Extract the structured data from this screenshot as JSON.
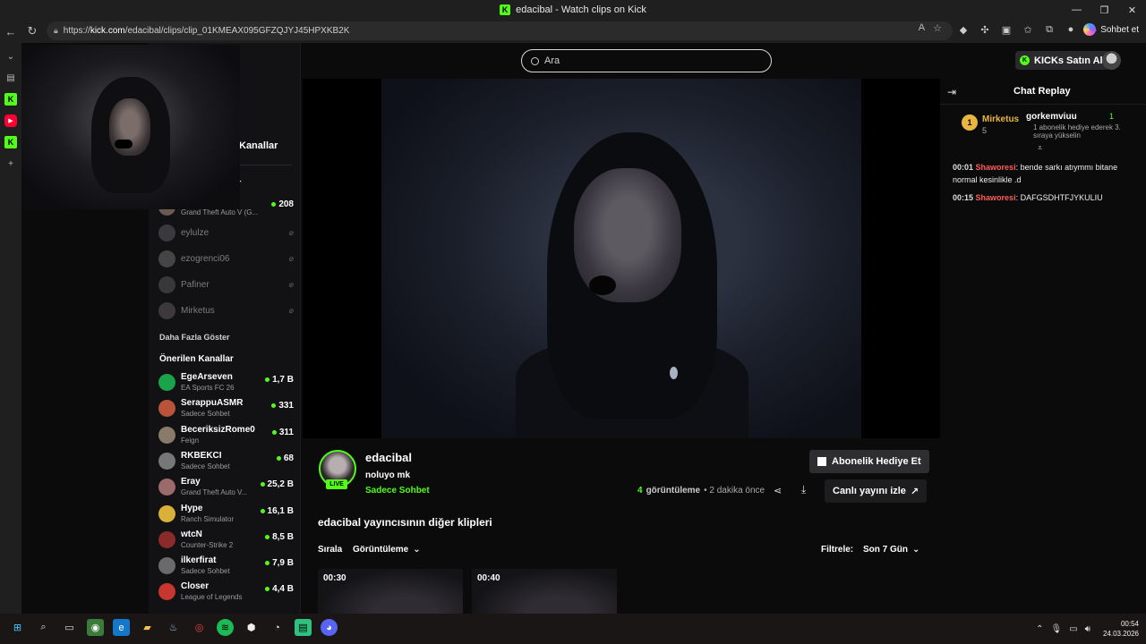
{
  "browser": {
    "window_title": "edacibal - Watch clips on Kick",
    "url_prefix": "https://",
    "url_host": "kick.com",
    "url_path": "/edacibal/clips/clip_01KMEAX095GFZQJYJ45HPXKB2K",
    "copilot_label": "Sohbet et"
  },
  "header": {
    "search_placeholder": "Ara",
    "kicks_button": "KICKs Satın Al"
  },
  "sidebar": {
    "heading": "Kanallar",
    "sub": "r",
    "followed": [
      {
        "name": "",
        "game": "Grand Theft Auto V (G...",
        "viewers": "208",
        "live": true
      },
      {
        "name": "eylulze",
        "live": false
      },
      {
        "name": "ezogrenci06",
        "live": false
      },
      {
        "name": "Pafiner",
        "live": false
      },
      {
        "name": "Mirketus",
        "live": false
      }
    ],
    "show_more": "Daha Fazla Göster",
    "recommended_title": "Önerilen Kanallar",
    "recommended": [
      {
        "name": "EgeArseven",
        "game": "EA Sports FC 26",
        "viewers": "1,7 B"
      },
      {
        "name": "SerappuASMR",
        "game": "Sadece Sohbet",
        "viewers": "331"
      },
      {
        "name": "BeceriksizRome0",
        "game": "Feign",
        "viewers": "311"
      },
      {
        "name": "RKBEKCI",
        "game": "Sadece Sohbet",
        "viewers": "68"
      },
      {
        "name": "Eray",
        "game": "Grand Theft Auto V...",
        "viewers": "25,2 B"
      },
      {
        "name": "Hype",
        "game": "Ranch Simulator",
        "viewers": "16,1 B"
      },
      {
        "name": "wtcN",
        "game": "Counter-Strike 2",
        "viewers": "8,5 B"
      },
      {
        "name": "ilkerfirat",
        "game": "Sadece Sohbet",
        "viewers": "7,9 B"
      },
      {
        "name": "Closer",
        "game": "League of Legends",
        "viewers": "4,4 B"
      }
    ]
  },
  "clip": {
    "streamer": "edacibal",
    "live_badge": "LIVE",
    "title": "noluyo mk",
    "category": "Sadece Sohbet",
    "views_count": "4",
    "views_label": "görüntüleme",
    "time_ago": "• 2 dakika önce",
    "gift_sub_button": "Abonelik Hediye Et",
    "watch_live_button": "Canlı yayını izle"
  },
  "more_clips": {
    "title": "edacibal yayıncısının diğer klipleri",
    "sort_label": "Sırala",
    "sort_value": "Görüntüleme",
    "filter_label": "Filtrele:",
    "filter_value": "Son 7 Gün",
    "thumbs": [
      {
        "duration": "00:30"
      },
      {
        "duration": "00:40"
      }
    ]
  },
  "chat": {
    "title": "Chat Replay",
    "pinned": {
      "rank": "1",
      "user": "Mirketus",
      "count": "5",
      "gifter": "gorkemviuu",
      "gifter_count": "1",
      "desc": "1 abonelik hediye ederek 3. sıraya yükselin"
    },
    "messages": [
      {
        "time": "00:01",
        "user": "Shaworesi",
        "text": ": bende sarkı atıymmı bitane normal kesinlikle .d"
      },
      {
        "time": "00:15",
        "user": "Shaworesi",
        "text": ": DAFGSDHTFJYKULIU"
      }
    ]
  },
  "taskbar": {
    "time": "00:54",
    "date": "24.03.2026"
  }
}
